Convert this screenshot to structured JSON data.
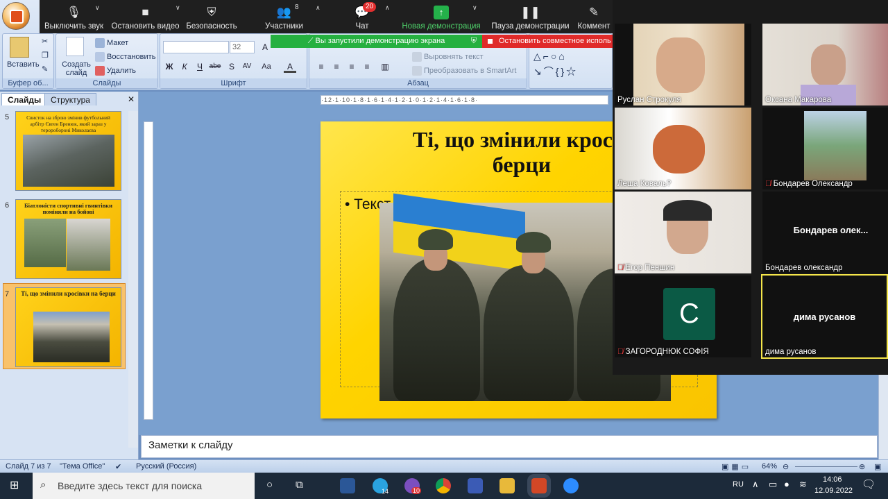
{
  "ribbon": {
    "clipboard": {
      "paste": "Вставить",
      "group": "Буфер об..."
    },
    "slides": {
      "create": "Создать слайд",
      "layout": "Макет",
      "reset": "Восстановить",
      "delete": "Удалить",
      "group": "Слайды"
    },
    "font": {
      "size": "32",
      "bold": "Ж",
      "italic": "К",
      "underline": "Ч",
      "strike": "abe",
      "shadow": "S",
      "spacing": "AV",
      "case": "Aa",
      "group": "Шрифт"
    },
    "paragraph": {
      "align_text": "Выровнять текст",
      "smartart": "Преобразовать в SmartArt",
      "group": "Абзац"
    }
  },
  "zoom_toolbar": {
    "mute": "Выключить звук",
    "stop_video": "Остановить видео",
    "security": "Безопасность",
    "participants": "Участники",
    "participants_count": "8",
    "chat": "Чат",
    "chat_badge": "20",
    "new_share": "Новая демонстрация",
    "pause_share": "Пауза демонстрации",
    "comment": "Коммент",
    "share_notice": "Вы запустили демонстрацию экрана",
    "stop_share": "Остановить совместное исполь"
  },
  "slides_pane": {
    "tab_slides": "Слайды",
    "tab_outline": "Структура",
    "thumbs": [
      {
        "num": "5",
        "title": "Свисток на зброю змінив футбольний арбітр Євген Бренюк, який зараз у тероробороні Миколаєва"
      },
      {
        "num": "6",
        "title": "Біатлоністи спортивні гвинтівки поміняли на бойові"
      },
      {
        "num": "7",
        "title": "Ті, що змінили кросівки на берци"
      }
    ]
  },
  "ruler": {
    "marks": "·12·1·10·1·8·1·6·1·4·1·2·1·0·1·2·1·4·1·6·1·8·"
  },
  "slide": {
    "title_line1": "Ті, що змінили кросів",
    "title_line2": "берци",
    "bullet": "• Текст слайда"
  },
  "notes_placeholder": "Заметки к слайду",
  "status": {
    "slide_pos": "Слайд 7 из 7",
    "theme": "\"Тема Office\"",
    "language": "Русский (Россия)",
    "zoom": "64%"
  },
  "taskbar": {
    "search_placeholder": "Введите здесь текст для поиска",
    "lang": "RU",
    "time": "14:06",
    "date": "12.09.2022",
    "telegram_badge": "14",
    "viber_badge": "10"
  },
  "gallery": {
    "participants": [
      {
        "name": "Руслан Строкуля",
        "muted": false,
        "video": true
      },
      {
        "name": "Оксана Макарова",
        "muted": false,
        "video": true
      },
      {
        "name": "Леша Коваль?",
        "muted": false,
        "video": true
      },
      {
        "name": "Бондарев Олександр",
        "muted": true,
        "video": true
      },
      {
        "name": "Егор Пеншин",
        "muted": true,
        "video": true
      },
      {
        "name": "Бондарев олександр",
        "muted": false,
        "video": false,
        "center_name": "Бондарев  олек..."
      },
      {
        "name": "ЗАГОРОДНЮК СОФІЯ",
        "muted": true,
        "video": false,
        "avatar_letter": "С"
      },
      {
        "name": "дима русанов",
        "muted": false,
        "video": false,
        "center_name": "дима русанов"
      }
    ]
  },
  "colors": {
    "slide_bg": "#ffd400",
    "zoom_toolbar_bg": "#1f1f1f",
    "share_green": "#25b040",
    "stop_red": "#e02a2a",
    "avatar_green": "#0b5a45",
    "active_speaker_border": "#f5e64a"
  }
}
